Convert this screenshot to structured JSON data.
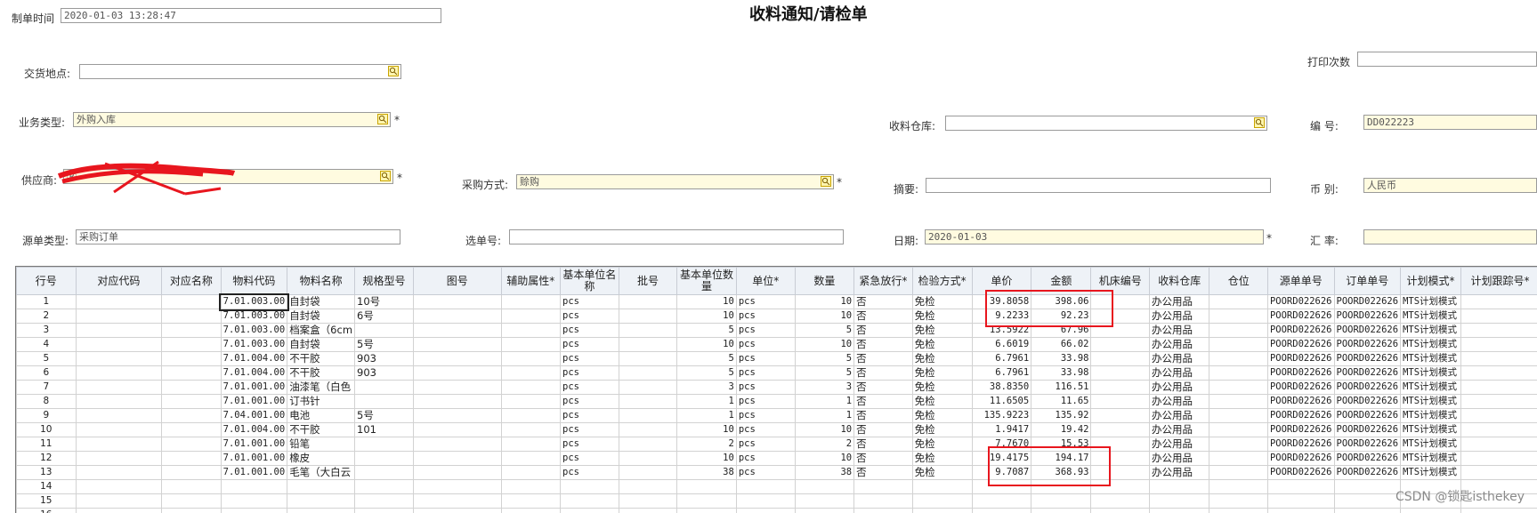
{
  "title": "收料通知/请检单",
  "header": {
    "create_time": {
      "label": "制单时间",
      "value": "2020-01-03 13:28:47"
    },
    "delivery_place": {
      "label": "交货地点:",
      "value": ""
    },
    "print_count": {
      "label": "打印次数",
      "value": ""
    },
    "business_type": {
      "label": "业务类型:",
      "value": "外购入库"
    },
    "receiving_warehouse": {
      "label": "收料仓库:",
      "value": ""
    },
    "number": {
      "label": "编    号:",
      "value": "DD022223"
    },
    "supplier": {
      "label": "供应商:",
      "value": "Ⓡ"
    },
    "purchase_method": {
      "label": "采购方式:",
      "value": "赊购"
    },
    "summary": {
      "label": "摘要:",
      "value": ""
    },
    "currency": {
      "label": "币    别:",
      "value": "人民币"
    },
    "source_type": {
      "label": "源单类型:",
      "value": "采购订单"
    },
    "select_no": {
      "label": "选单号:",
      "value": ""
    },
    "date": {
      "label": "日期:",
      "value": "2020-01-03"
    },
    "exchange_rate": {
      "label": "汇    率:",
      "value": ""
    },
    "required_mark": "*"
  },
  "columns": [
    "行号",
    "对应代码",
    "对应名称",
    "物料代码",
    "物料名称",
    "规格型号",
    "图号",
    "辅助属性*",
    "基本单位名称",
    "批号",
    "基本单位数量",
    "单位*",
    "数量",
    "紧急放行*",
    "检验方式*",
    "单价",
    "金额",
    "机床编号",
    "收料仓库",
    "仓位",
    "源单单号",
    "订单单号",
    "计划模式*",
    "计划跟踪号*"
  ],
  "rows": [
    [
      "1",
      "",
      "",
      "7.01.003.00",
      "自封袋",
      "10号",
      "",
      "",
      "pcs",
      "",
      "10",
      "pcs",
      "10",
      "否",
      "免检",
      "39.8058",
      "398.06",
      "",
      "办公用品",
      "",
      "POORD022626",
      "POORD022626",
      "MTS计划模式",
      ""
    ],
    [
      "2",
      "",
      "",
      "7.01.003.00",
      "自封袋",
      "6号",
      "",
      "",
      "pcs",
      "",
      "10",
      "pcs",
      "10",
      "否",
      "免检",
      "9.2233",
      "92.23",
      "",
      "办公用品",
      "",
      "POORD022626",
      "POORD022626",
      "MTS计划模式",
      ""
    ],
    [
      "3",
      "",
      "",
      "7.01.003.00",
      "档案盒（6cm",
      "",
      "",
      "",
      "pcs",
      "",
      "5",
      "pcs",
      "5",
      "否",
      "免检",
      "13.5922",
      "67.96",
      "",
      "办公用品",
      "",
      "POORD022626",
      "POORD022626",
      "MTS计划模式",
      ""
    ],
    [
      "4",
      "",
      "",
      "7.01.003.00",
      "自封袋",
      "5号",
      "",
      "",
      "pcs",
      "",
      "10",
      "pcs",
      "10",
      "否",
      "免检",
      "6.6019",
      "66.02",
      "",
      "办公用品",
      "",
      "POORD022626",
      "POORD022626",
      "MTS计划模式",
      ""
    ],
    [
      "5",
      "",
      "",
      "7.01.004.00",
      "不干胶",
      "903",
      "",
      "",
      "pcs",
      "",
      "5",
      "pcs",
      "5",
      "否",
      "免检",
      "6.7961",
      "33.98",
      "",
      "办公用品",
      "",
      "POORD022626",
      "POORD022626",
      "MTS计划模式",
      ""
    ],
    [
      "6",
      "",
      "",
      "7.01.004.00",
      "不干胶",
      "903",
      "",
      "",
      "pcs",
      "",
      "5",
      "pcs",
      "5",
      "否",
      "免检",
      "6.7961",
      "33.98",
      "",
      "办公用品",
      "",
      "POORD022626",
      "POORD022626",
      "MTS计划模式",
      ""
    ],
    [
      "7",
      "",
      "",
      "7.01.001.00",
      "油漆笔（白色",
      "",
      "",
      "",
      "pcs",
      "",
      "3",
      "pcs",
      "3",
      "否",
      "免检",
      "38.8350",
      "116.51",
      "",
      "办公用品",
      "",
      "POORD022626",
      "POORD022626",
      "MTS计划模式",
      ""
    ],
    [
      "8",
      "",
      "",
      "7.01.001.00",
      "订书针",
      "",
      "",
      "",
      "pcs",
      "",
      "1",
      "pcs",
      "1",
      "否",
      "免检",
      "11.6505",
      "11.65",
      "",
      "办公用品",
      "",
      "POORD022626",
      "POORD022626",
      "MTS计划模式",
      ""
    ],
    [
      "9",
      "",
      "",
      "7.04.001.00",
      "电池",
      "5号",
      "",
      "",
      "pcs",
      "",
      "1",
      "pcs",
      "1",
      "否",
      "免检",
      "135.9223",
      "135.92",
      "",
      "办公用品",
      "",
      "POORD022626",
      "POORD022626",
      "MTS计划模式",
      ""
    ],
    [
      "10",
      "",
      "",
      "7.01.004.00",
      "不干胶",
      "101",
      "",
      "",
      "pcs",
      "",
      "10",
      "pcs",
      "10",
      "否",
      "免检",
      "1.9417",
      "19.42",
      "",
      "办公用品",
      "",
      "POORD022626",
      "POORD022626",
      "MTS计划模式",
      ""
    ],
    [
      "11",
      "",
      "",
      "7.01.001.00",
      "铅笔",
      "",
      "",
      "",
      "pcs",
      "",
      "2",
      "pcs",
      "2",
      "否",
      "免检",
      "7.7670",
      "15.53",
      "",
      "办公用品",
      "",
      "POORD022626",
      "POORD022626",
      "MTS计划模式",
      ""
    ],
    [
      "12",
      "",
      "",
      "7.01.001.00",
      "橡皮",
      "",
      "",
      "",
      "pcs",
      "",
      "10",
      "pcs",
      "10",
      "否",
      "免检",
      "19.4175",
      "194.17",
      "",
      "办公用品",
      "",
      "POORD022626",
      "POORD022626",
      "MTS计划模式",
      ""
    ],
    [
      "13",
      "",
      "",
      "7.01.001.00",
      "毛笔（大白云",
      "",
      "",
      "",
      "pcs",
      "",
      "38",
      "pcs",
      "38",
      "否",
      "免检",
      "9.7087",
      "368.93",
      "",
      "办公用品",
      "",
      "POORD022626",
      "POORD022626",
      "MTS计划模式",
      ""
    ],
    [
      "14",
      "",
      "",
      "",
      "",
      "",
      "",
      "",
      "",
      "",
      "",
      "",
      "",
      "",
      "",
      "",
      "",
      "",
      "",
      "",
      "",
      "",
      "",
      ""
    ],
    [
      "15",
      "",
      "",
      "",
      "",
      "",
      "",
      "",
      "",
      "",
      "",
      "",
      "",
      "",
      "",
      "",
      "",
      "",
      "",
      "",
      "",
      "",
      "",
      ""
    ],
    [
      "16",
      "",
      "",
      "",
      "",
      "",
      "",
      "",
      "",
      "",
      "",
      "",
      "",
      "",
      "",
      "",
      "",
      "",
      "",
      "",
      "",
      "",
      "",
      ""
    ]
  ],
  "watermark": "CSDN @锁匙isthekey",
  "colors": {
    "highlight": "#e8161e",
    "required_field_bg": "#fffbe0",
    "header_bg": "#eef2f7"
  }
}
